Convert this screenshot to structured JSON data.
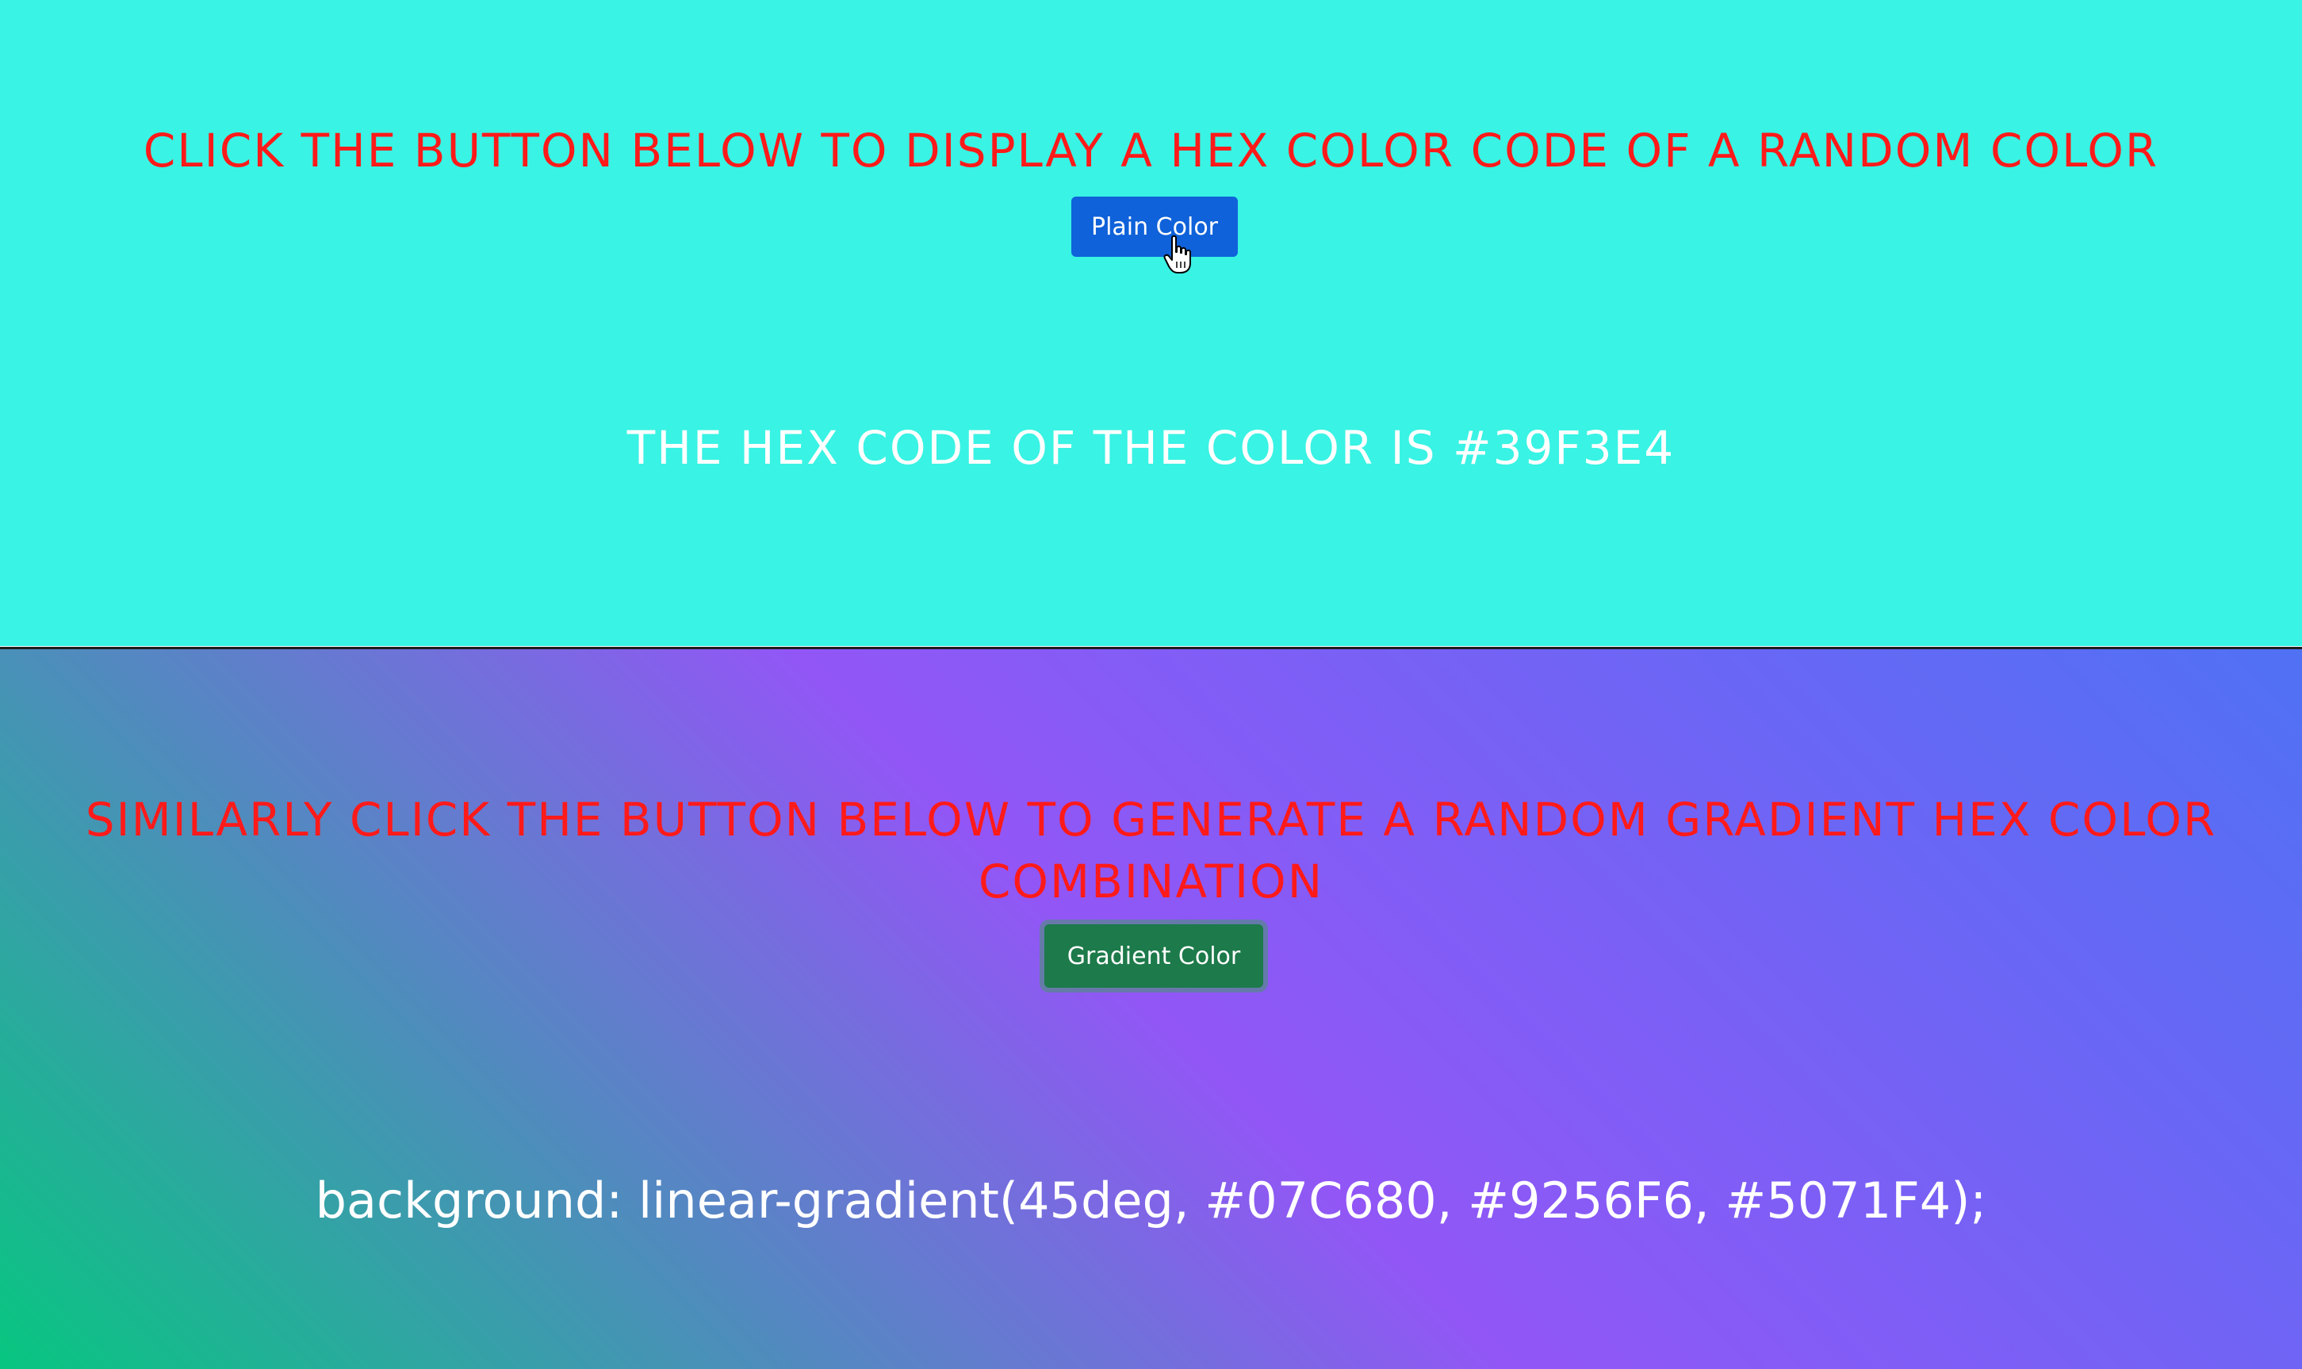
{
  "plain_section": {
    "heading": "Click the button below to display a hex color code of a random color",
    "button_label": "Plain Color",
    "result_text": "The hex code of the color is #39F3E4",
    "background_color": "#39F3E4"
  },
  "gradient_section": {
    "heading": "Similarly click the button below to generate a random gradient hex color combination",
    "button_label": "Gradient Color",
    "result_text": "background: linear-gradient(45deg, #07C680, #9256F6, #5071F4);",
    "gradient_colors": [
      "#07C680",
      "#9256F6",
      "#5071F4"
    ]
  },
  "colors": {
    "heading_text": "#ff1a1a",
    "plain_button": "#0f62d9",
    "gradient_button": "#1d7a4a",
    "result_text": "#ffffff"
  },
  "icons": {
    "cursor": "hand-pointer-icon"
  }
}
